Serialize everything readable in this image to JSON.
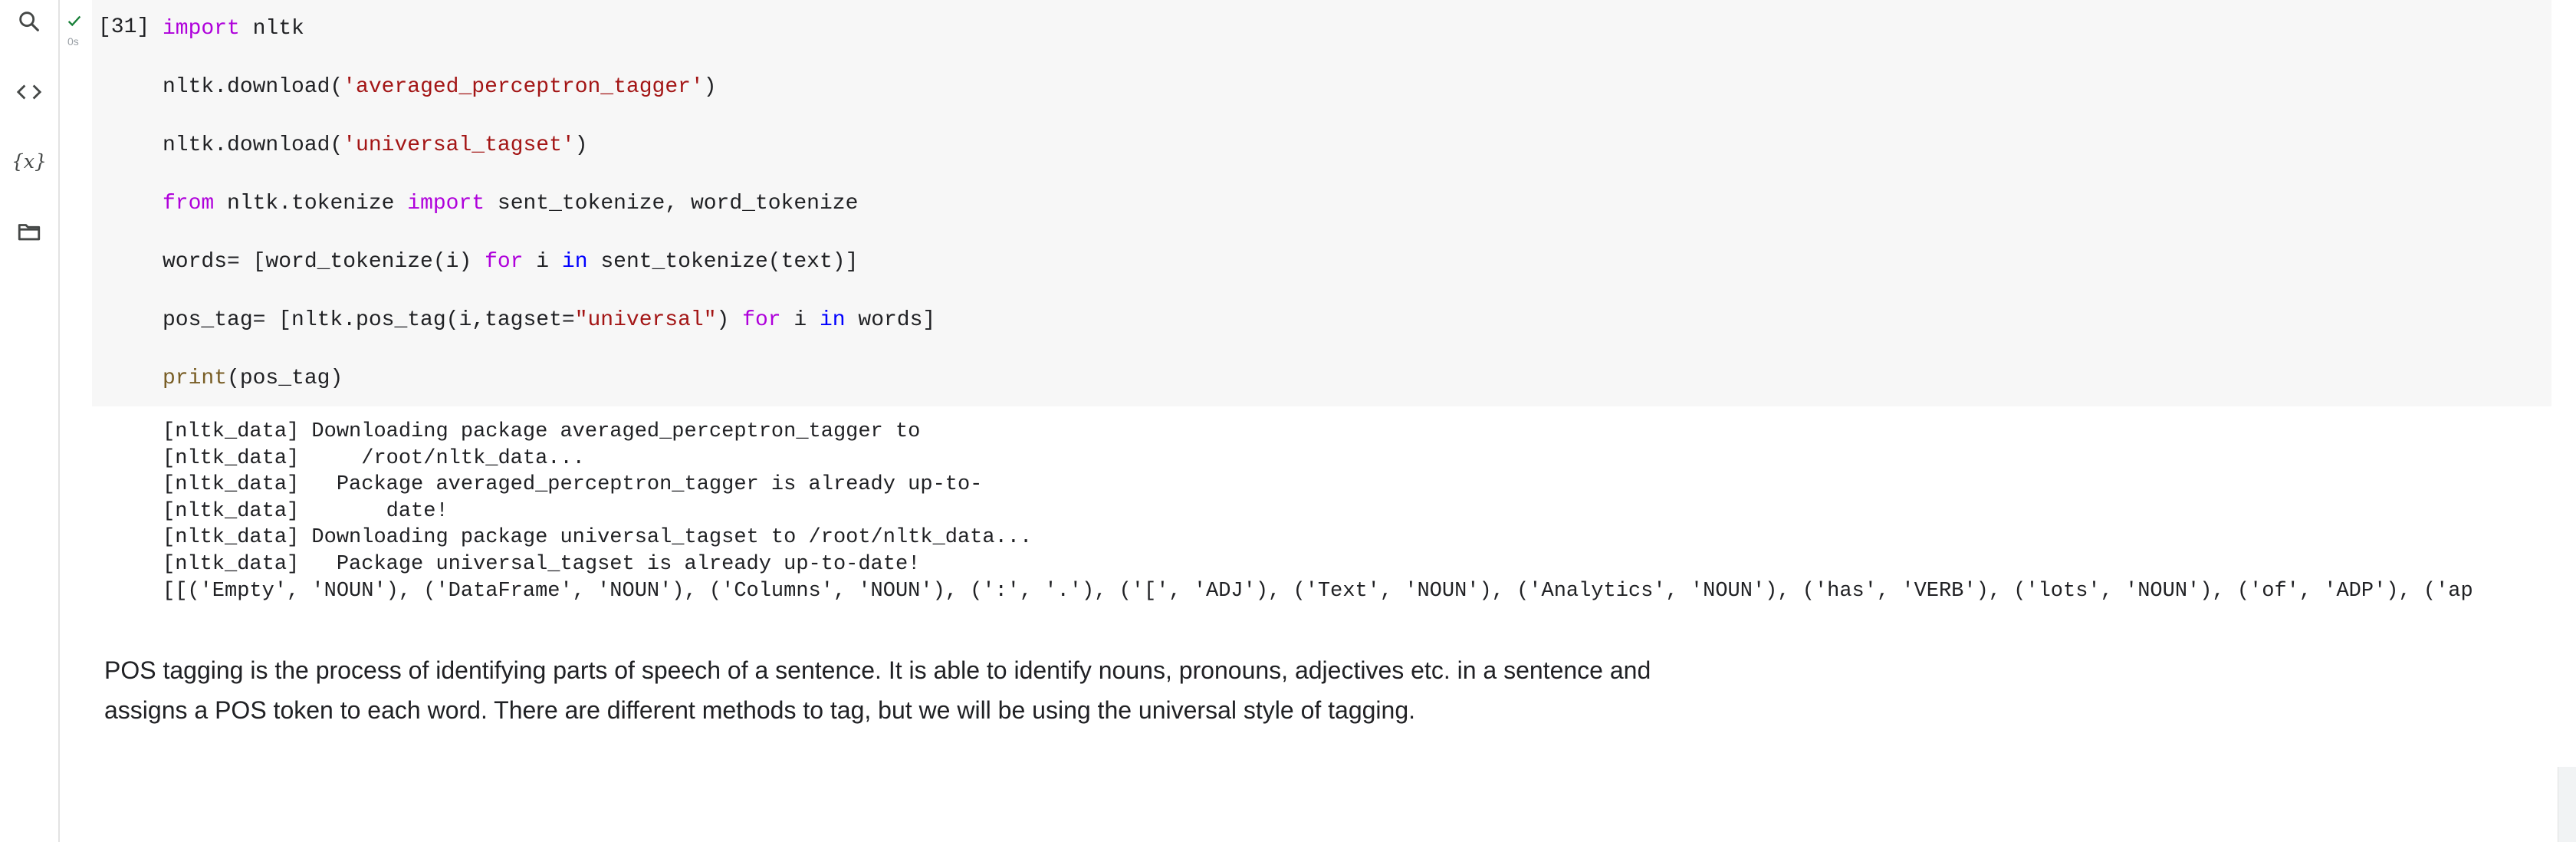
{
  "sidebar": {
    "items": [
      {
        "name": "search",
        "icon": "search-icon"
      },
      {
        "name": "code-snippets",
        "icon": "code-icon"
      },
      {
        "name": "variables",
        "icon": "variables-icon",
        "glyph": "{x}"
      },
      {
        "name": "files",
        "icon": "folder-icon"
      }
    ]
  },
  "code_cell": {
    "execution_count": "[31]",
    "run_time": "0s",
    "status": "success",
    "lines": [
      {
        "parts": [
          {
            "t": "import",
            "c": "kw"
          },
          {
            "t": " nltk",
            "c": ""
          }
        ]
      },
      {
        "parts": [
          {
            "t": "nltk.download(",
            "c": ""
          },
          {
            "t": "'averaged_perceptron_tagger'",
            "c": "str"
          },
          {
            "t": ")",
            "c": ""
          }
        ]
      },
      {
        "parts": [
          {
            "t": "nltk.download(",
            "c": ""
          },
          {
            "t": "'universal_tagset'",
            "c": "str"
          },
          {
            "t": ")",
            "c": ""
          }
        ]
      },
      {
        "parts": [
          {
            "t": "from",
            "c": "kw"
          },
          {
            "t": " nltk.tokenize ",
            "c": ""
          },
          {
            "t": "import",
            "c": "kw"
          },
          {
            "t": " sent_tokenize, word_tokenize",
            "c": ""
          }
        ]
      },
      {
        "parts": [
          {
            "t": "words= [word_tokenize(i) ",
            "c": ""
          },
          {
            "t": "for",
            "c": "kw"
          },
          {
            "t": " i ",
            "c": ""
          },
          {
            "t": "in",
            "c": "kw2"
          },
          {
            "t": " sent_tokenize(text)]",
            "c": ""
          }
        ]
      },
      {
        "parts": [
          {
            "t": "pos_tag= [nltk.pos_tag(i,tagset=",
            "c": ""
          },
          {
            "t": "\"universal\"",
            "c": "str"
          },
          {
            "t": ") ",
            "c": ""
          },
          {
            "t": "for",
            "c": "kw"
          },
          {
            "t": " i ",
            "c": ""
          },
          {
            "t": "in",
            "c": "kw2"
          },
          {
            "t": " words]",
            "c": ""
          }
        ]
      },
      {
        "parts": [
          {
            "t": "print",
            "c": "fn"
          },
          {
            "t": "(pos_tag)",
            "c": ""
          }
        ]
      }
    ]
  },
  "output": {
    "lines": [
      "[nltk_data] Downloading package averaged_perceptron_tagger to",
      "[nltk_data]     /root/nltk_data...",
      "[nltk_data]   Package averaged_perceptron_tagger is already up-to-",
      "[nltk_data]       date!",
      "[nltk_data] Downloading package universal_tagset to /root/nltk_data...",
      "[nltk_data]   Package universal_tagset is already up-to-date!",
      "[[('Empty', 'NOUN'), ('DataFrame', 'NOUN'), ('Columns', 'NOUN'), (':', '.'), ('[', 'ADJ'), ('Text', 'NOUN'), ('Analytics', 'NOUN'), ('has', 'VERB'), ('lots', 'NOUN'), ('of', 'ADP'), ('ap"
    ]
  },
  "text_cell": {
    "paragraph": "POS tagging is the process of identifying parts of speech of a sentence. It is able to identify nouns, pronouns, adjectives etc. in a sentence and assigns a POS token to each word. There are different methods to tag, but we will be using the universal style of tagging."
  },
  "colors": {
    "keyword": "#af00db",
    "keyword_in": "#0000ff",
    "string": "#a31515",
    "function": "#795e26",
    "success": "#188038",
    "editor_bg": "#f7f7f7"
  }
}
